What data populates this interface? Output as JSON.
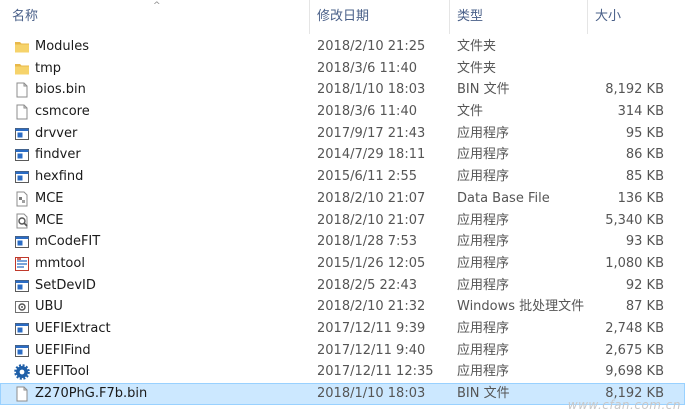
{
  "columns": {
    "name": "名称",
    "date": "修改日期",
    "type": "类型",
    "size": "大小"
  },
  "sort_arrow": "^",
  "files": [
    {
      "icon": "folder-icon",
      "name": "Modules",
      "date": "2018/2/10 21:25",
      "type": "文件夹",
      "size": ""
    },
    {
      "icon": "folder-icon",
      "name": "tmp",
      "date": "2018/3/6 11:40",
      "type": "文件夹",
      "size": ""
    },
    {
      "icon": "file-icon",
      "name": "bios.bin",
      "date": "2018/1/10 18:03",
      "type": "BIN 文件",
      "size": "8,192 KB"
    },
    {
      "icon": "file-icon",
      "name": "csmcore",
      "date": "2018/3/6 11:40",
      "type": "文件",
      "size": "314 KB"
    },
    {
      "icon": "app-icon",
      "name": "drvver",
      "date": "2017/9/17 21:43",
      "type": "应用程序",
      "size": "95 KB"
    },
    {
      "icon": "app-icon",
      "name": "findver",
      "date": "2014/7/29 18:11",
      "type": "应用程序",
      "size": "86 KB"
    },
    {
      "icon": "app-icon",
      "name": "hexfind",
      "date": "2015/6/11 2:55",
      "type": "应用程序",
      "size": "85 KB"
    },
    {
      "icon": "database-file-icon",
      "name": "MCE",
      "date": "2018/2/10 21:07",
      "type": "Data Base File",
      "size": "136 KB"
    },
    {
      "icon": "magnifier-app-icon",
      "name": "MCE",
      "date": "2018/2/10 21:07",
      "type": "应用程序",
      "size": "5,340 KB"
    },
    {
      "icon": "app-icon",
      "name": "mCodeFIT",
      "date": "2018/1/28 7:53",
      "type": "应用程序",
      "size": "93 KB"
    },
    {
      "icon": "mmtool-icon",
      "name": "mmtool",
      "date": "2015/1/26 12:05",
      "type": "应用程序",
      "size": "1,080 KB"
    },
    {
      "icon": "app-icon",
      "name": "SetDevID",
      "date": "2018/2/5 22:43",
      "type": "应用程序",
      "size": "92 KB"
    },
    {
      "icon": "batch-file-icon",
      "name": "UBU",
      "date": "2018/2/10 21:32",
      "type": "Windows 批处理文件",
      "size": "87 KB"
    },
    {
      "icon": "app-icon",
      "name": "UEFIExtract",
      "date": "2017/12/11 9:39",
      "type": "应用程序",
      "size": "2,748 KB"
    },
    {
      "icon": "app-icon",
      "name": "UEFIFind",
      "date": "2017/12/11 9:40",
      "type": "应用程序",
      "size": "2,675 KB"
    },
    {
      "icon": "gear-app-icon",
      "name": "UEFITool",
      "date": "2017/12/11 12:35",
      "type": "应用程序",
      "size": "9,698 KB"
    },
    {
      "icon": "file-icon",
      "name": "Z270PhG.F7b.bin",
      "date": "2018/1/10 18:03",
      "type": "BIN 文件",
      "size": "8,192 KB",
      "selected": true
    }
  ],
  "watermark": "www.cfan.com.cn"
}
